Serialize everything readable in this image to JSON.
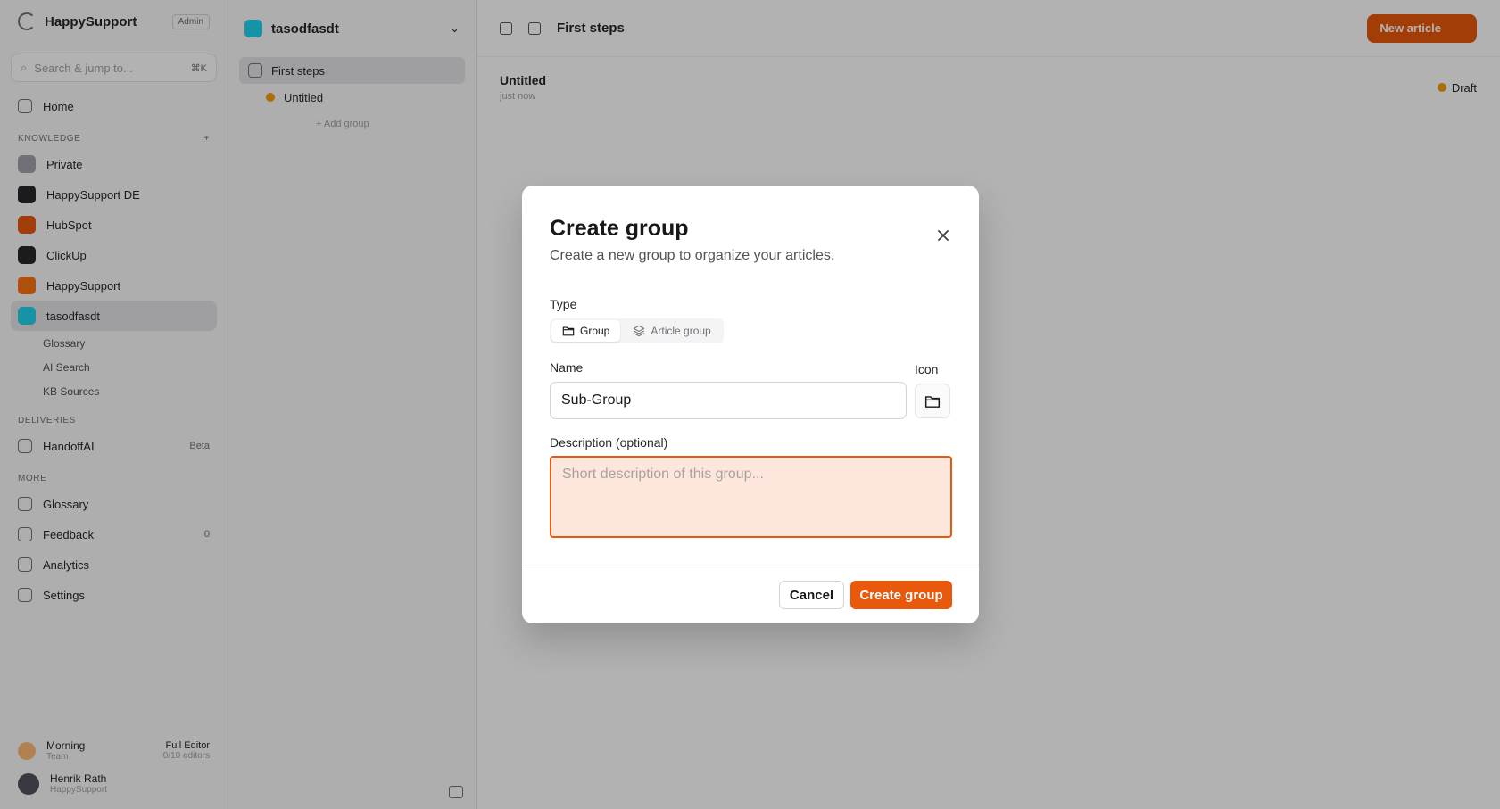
{
  "sidebar": {
    "brand": "HappySupport",
    "brand_badge": "Admin",
    "search_placeholder": "Search & jump to...",
    "search_kbd": "⌘K",
    "home": "Home",
    "knowledge_label": "Knowledge",
    "knowledge_bases": [
      {
        "label": "Private",
        "color": "#a1a1aa"
      },
      {
        "label": "HappySupport DE",
        "color": "#27272a"
      },
      {
        "label": "HubSpot",
        "color": "#ea580c"
      },
      {
        "label": "ClickUp",
        "color": "#27272a"
      },
      {
        "label": "HappySupport",
        "color": "#f97316"
      },
      {
        "label": "tasodfasdt",
        "color": "#22d3ee"
      }
    ],
    "kb_subitems": [
      "Glossary",
      "AI Search",
      "KB Sources"
    ],
    "deliveries_label": "Deliveries",
    "deliveries": [
      {
        "label": "HandoffAI",
        "meta": "Beta"
      }
    ],
    "more_label": "More",
    "more_items": [
      "Glossary",
      "Feedback",
      "Analytics",
      "Settings"
    ],
    "feedback_count": "0",
    "footer": {
      "greeting": "Morning",
      "greeting_sub": "Team",
      "plan": "Full Editor",
      "plan_sub": "0/10 editors",
      "user_name": "Henrik Rath",
      "user_org": "HappySupport"
    }
  },
  "tree": {
    "title": "tasodfasdt",
    "first_steps": "First steps",
    "untitled": "Untitled",
    "add_group": "+ Add group"
  },
  "main": {
    "breadcrumb": "First steps",
    "new_article": "New article",
    "doc_title": "Untitled",
    "doc_sub": "just now",
    "status": "Draft"
  },
  "dialog": {
    "title": "Create group",
    "subtitle": "Create a new group to organize your articles.",
    "type_label": "Type",
    "type_options": [
      {
        "label": "Group",
        "icon": "folder-icon",
        "selected": true
      },
      {
        "label": "Article group",
        "icon": "layers-icon",
        "selected": false
      }
    ],
    "name_label": "Name",
    "name_value": "Sub-Group",
    "icon_label": "Icon",
    "icon_value": "folder-icon",
    "description_label": "Description (optional)",
    "description_placeholder": "Short description of this group...",
    "description_value": "",
    "cancel": "Cancel",
    "submit": "Create group"
  },
  "colors": {
    "accent": "#ea580c",
    "overlay": "rgba(0,0,0,0.30)",
    "focus_fill": "#fde6dc"
  }
}
